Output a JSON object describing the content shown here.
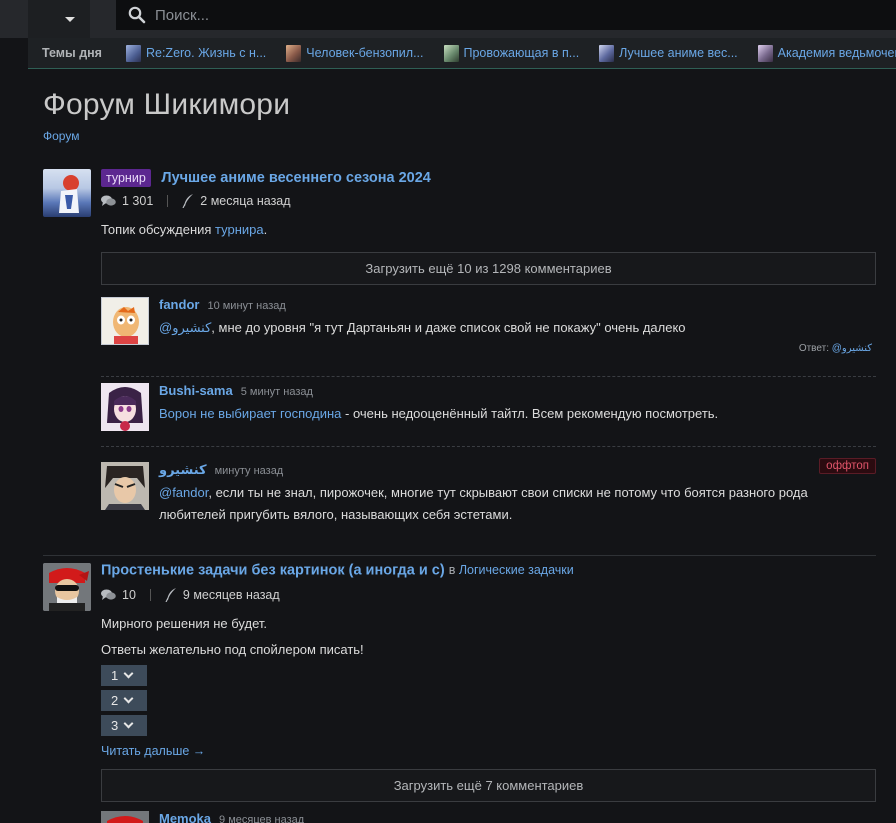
{
  "search": {
    "placeholder": "Поиск..."
  },
  "topics_bar": {
    "label": "Темы дня",
    "items": [
      {
        "label": "Re:Zero. Жизнь с н...",
        "thumb_color": "#4c5e92"
      },
      {
        "label": "Человек-бензопил...",
        "thumb_color": "#8a5a4a"
      },
      {
        "label": "Провожающая в п...",
        "thumb_color": "#6a8a6e"
      },
      {
        "label": "Лучшее аниме вес...",
        "thumb_color": "#5e6aa0"
      },
      {
        "label": "Академия ведьмочек",
        "thumb_color": "#7a6a8e"
      }
    ]
  },
  "page": {
    "title": "Форум Шикимори",
    "breadcrumb": "Форум"
  },
  "topic1": {
    "tag": "турнир",
    "title": "Лучшее аниме весеннего сезона 2024",
    "comments_count": "1 301",
    "time": "2 месяца назад",
    "body_prefix": "Топик обсуждения ",
    "body_link": "турнира",
    "body_suffix": ".",
    "load_more": "Загрузить ещё 10 из 1298 комментариев",
    "comments": [
      {
        "author": "fandor",
        "time": "10 минут назад",
        "mention": "@كنشيرو",
        "text": ", мне до уровня \"я тут Дартаньян и даже список свой не покажу\" очень далеко",
        "reply_label": "Ответ: ",
        "reply_link": "@كنشيرو"
      },
      {
        "author": "Bushi-sama",
        "time": "5 минут назад",
        "link": "Ворон не выбирает господина",
        "text": " - очень недооценённый тайтл. Всем рекомендую посмотреть."
      },
      {
        "author": "كنشيرو",
        "time": "минуту назад",
        "badge": "оффтоп",
        "mention": "@fandor",
        "text": ", если ты не знал, пирожочек, многие тут скрывают свои списки не потому что боятся разного рода любителей пригубить вялого, называющих себя эстетами."
      }
    ]
  },
  "topic2": {
    "title": "Простенькие задачи без картинок (а иногда и с)",
    "in_label": "в",
    "section": "Логические задачки",
    "comments_count": "10",
    "time": "9 месяцев назад",
    "body_line1": "Мирного решения не будет.",
    "body_line2": "Ответы желательно под спойлером писать!",
    "spoilers": [
      "1",
      "2",
      "3"
    ],
    "read_more": "Читать дальше →",
    "load_more": "Загрузить ещё 7 комментариев",
    "next_comment": {
      "author": "Memoka",
      "time": "9 месяцев назад"
    }
  }
}
